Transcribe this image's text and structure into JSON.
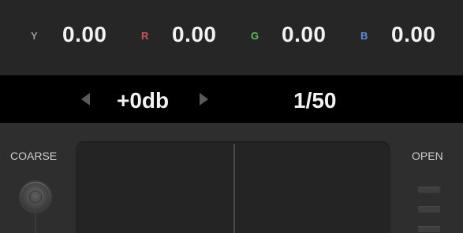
{
  "readout": {
    "channels": [
      {
        "letter": "Y",
        "value": "0.00",
        "color": "#9a9a9a"
      },
      {
        "letter": "R",
        "value": "0.00",
        "color": "#d0535e"
      },
      {
        "letter": "G",
        "value": "0.00",
        "color": "#5fbf5f"
      },
      {
        "letter": "B",
        "value": "0.00",
        "color": "#5d8fd6"
      }
    ]
  },
  "strip": {
    "gain": "+0db",
    "shutter": "1/50",
    "prev_icon": "triangle-left-icon",
    "next_icon": "triangle-right-icon"
  },
  "controls": {
    "left_label": "COARSE",
    "right_label": "OPEN"
  }
}
